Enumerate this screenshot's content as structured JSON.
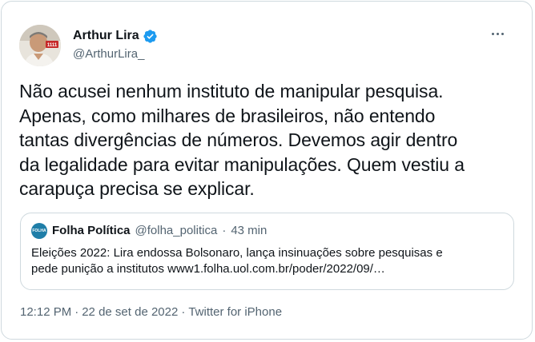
{
  "author": {
    "name": "Arthur Lira",
    "handle": "@ArthurLira_",
    "verified_icon": "verified-badge-icon",
    "verified_color": "#1d9bf0",
    "avatar_badge": "1111"
  },
  "tweet": {
    "text": "Não acusei nenhum instituto de manipular pesquisa.\nApenas, como milhares de brasileiros, não entendo\ntantas divergências de números. Devemos agir dentro\nda legalidade para evitar manipulações. Quem vestiu a\ncarapuça precisa se explicar."
  },
  "quote": {
    "avatar_text": "FOLHA",
    "name": "Folha Política",
    "handle": "@folha_politica",
    "separator": "·",
    "time": "43 min",
    "text": "Eleições 2022: Lira endossa Bolsonaro, lança insinuações sobre pesquisas e\npede punição a institutos www1.folha.uol.com.br/poder/2022/09/…"
  },
  "meta": {
    "time": "12:12 PM",
    "separator": "·",
    "date": "22 de set de 2022",
    "source": "Twitter for iPhone"
  },
  "menu_icon": "more-options-icon"
}
